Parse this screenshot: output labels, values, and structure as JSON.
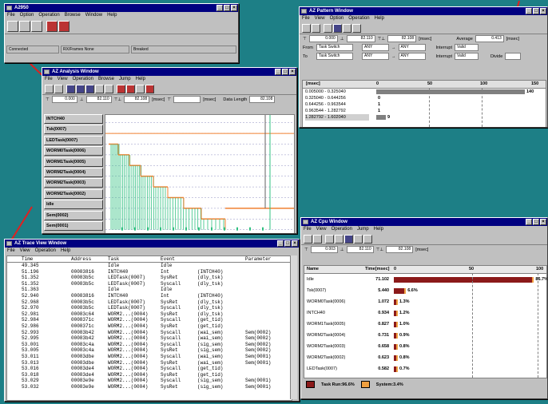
{
  "a2950": {
    "title": "A2950",
    "menu": [
      "File",
      "Option",
      "Operation",
      "Browse",
      "Window",
      "Help"
    ],
    "status": [
      "Connected",
      "RX/Frames None",
      "Breaked"
    ]
  },
  "analysis": {
    "title": "AZ Analysis Window",
    "menu": [
      "File",
      "View",
      "Operation",
      "Browse",
      "Jump",
      "Help"
    ],
    "t_start": "0.000",
    "t_end": "82.110",
    "t_range": "82.108",
    "unit": "[msec]",
    "data_length_label": "Data Length",
    "data_length": "82.108",
    "tasks": [
      "INTCH40",
      "Tsk(0007)",
      "LEDTask(0007)",
      "WORM0Task(0006)",
      "WORM1Task(0005)",
      "WORM2Task(0004)",
      "WORM2Task(0003)",
      "WORM2Task(0002)",
      "Idle",
      "Sem(0002)",
      "Sem(0001)"
    ]
  },
  "pattern": {
    "title": "AZ Pattern Window",
    "menu": [
      "File",
      "View",
      "Option",
      "Operation",
      "Help"
    ],
    "t_start": "0.000",
    "t_end": "82.110",
    "t_range": "82.108",
    "unit": "[msec]",
    "from_label": "From",
    "from_value": "Task Switch",
    "from_any1": "ANY",
    "from_any2": "ANY",
    "to_label": "To",
    "to_value": "Task Switch",
    "to_any1": "ANY",
    "to_any2": "ANY",
    "average_label": "Average",
    "average": "0.413",
    "unit2": "[msec]",
    "interrupt_label": "Interrupt",
    "interrupt_value": "Valid",
    "divide_label": "Divide",
    "col_range": "[msec]",
    "scale": [
      "0",
      "50",
      "100",
      "150"
    ],
    "rows": [
      {
        "range": "0.005000 - 0.325040",
        "count": "140",
        "frac": 0.93
      },
      {
        "range": "0.325040 - 0.644256",
        "count": "0",
        "frac": 0
      },
      {
        "range": "0.644256 - 0.963544",
        "count": "1",
        "frac": 0
      },
      {
        "range": "0.963544 - 1.282792",
        "count": "1",
        "frac": 0
      },
      {
        "range": "1.282792 - 1.602040",
        "count": "9",
        "frac": 0.06
      }
    ]
  },
  "cpu": {
    "title": "AZ Cpu Window",
    "menu": [
      "File",
      "View",
      "Operation",
      "Jump",
      "Help"
    ],
    "t_start": "0.003",
    "t_end": "82.110",
    "t_range": "82.108",
    "unit": "[msec]",
    "col_name": "Name",
    "col_time": "Time[msec]",
    "scale": [
      "0",
      "50",
      "100"
    ],
    "rows": [
      {
        "name": "Idle",
        "time": "71.102",
        "pct": "86.7%",
        "frac": 0.867
      },
      {
        "name": "Tsk(0007)",
        "time": "5.440",
        "pct": "6.6%",
        "frac": 0.066
      },
      {
        "name": "WORM0Task(0006)",
        "time": "1.072",
        "pct": "1.3%",
        "frac": 0.013
      },
      {
        "name": "INTCH40",
        "time": "0.934",
        "pct": "1.2%",
        "frac": 0.012
      },
      {
        "name": "WORM1Task(0005)",
        "time": "0.827",
        "pct": "1.0%",
        "frac": 0.01
      },
      {
        "name": "WORM2Task(0004)",
        "time": "0.731",
        "pct": "0.9%",
        "frac": 0.009
      },
      {
        "name": "WORM2Task(0003)",
        "time": "0.658",
        "pct": "0.8%",
        "frac": 0.008
      },
      {
        "name": "WORM2Task(0002)",
        "time": "0.623",
        "pct": "0.8%",
        "frac": 0.008
      },
      {
        "name": "LEDTask(0007)",
        "time": "0.582",
        "pct": "0.7%",
        "frac": 0.007
      }
    ],
    "legend_task": "Task Run:96.6%",
    "legend_system": "System:3.4%"
  },
  "trace": {
    "title": "AZ Trace View Window",
    "menu": [
      "File",
      "View",
      "Operation",
      "Help"
    ],
    "headers": [
      "Time",
      "Address",
      "Task",
      "Event",
      "",
      "Parameter"
    ],
    "rows": [
      [
        "49.345",
        "",
        "Idle",
        "Idle",
        "",
        ""
      ],
      [
        "51.196",
        "00083816",
        "INTCH40",
        "Int",
        "(INTCH40)",
        ""
      ],
      [
        "51.352",
        "00083b5c",
        "LEDTask(0007)",
        "SysRet",
        "(dly_tsk)",
        ""
      ],
      [
        "51.352",
        "00083b5c",
        "LEDTask(0007)",
        "Syscall",
        "(dly_tsk)",
        ""
      ],
      [
        "51.363",
        "",
        "Idle",
        "Idle",
        "",
        ""
      ],
      [
        "52.940",
        "00083816",
        "INTCH40",
        "Int",
        "(INTCH40)",
        ""
      ],
      [
        "52.968",
        "00083b5c",
        "LEDTask(0007)",
        "SysRet",
        "(dly_tsk)",
        ""
      ],
      [
        "52.970",
        "00083b5c",
        "LEDTask(0007)",
        "Syscall",
        "(dly_tsk)",
        ""
      ],
      [
        "52.981",
        "00083c64",
        "WORM2...(0004)",
        "SysRet",
        "(dly_tsk)",
        ""
      ],
      [
        "52.984",
        "0008371c",
        "WORM2...(0004)",
        "Syscall",
        "(get_tid)",
        ""
      ],
      [
        "52.986",
        "0008371c",
        "WORM2...(0004)",
        "SysRet",
        "(get_tid)",
        ""
      ],
      [
        "52.993",
        "00083b42",
        "WORM2...(0004)",
        "Syscall",
        "(wai_sem)",
        "Sem(0002)"
      ],
      [
        "52.995",
        "00083b42",
        "WORM2...(0004)",
        "Syscall",
        "(wai_sem)",
        "Sem(0002)"
      ],
      [
        "53.001",
        "00083c4a",
        "WORM2...(0004)",
        "Syscall",
        "(sig_sem)",
        "Sem(0002)"
      ],
      [
        "53.005",
        "00083c4a",
        "WORM2...(0004)",
        "SysRet",
        "(sig_sem)",
        "Sem(0002)"
      ],
      [
        "53.011",
        "00083dbe",
        "WORM2...(0004)",
        "Syscall",
        "(wai_sem)",
        "Sem(0001)"
      ],
      [
        "53.013",
        "00083dbe",
        "WORM2...(0004)",
        "SysRet",
        "(wai_sem)",
        "Sem(0001)"
      ],
      [
        "53.016",
        "00083de4",
        "WORM2...(0004)",
        "Syscall",
        "(get_tid)",
        ""
      ],
      [
        "53.018",
        "00083de4",
        "WORM2...(0004)",
        "SysRet",
        "(get_tid)",
        ""
      ],
      [
        "53.029",
        "00083e9e",
        "WORM2...(0004)",
        "Syscall",
        "(sig_sem)",
        "Sem(0001)"
      ],
      [
        "53.032",
        "00083e9e",
        "WORM2...(0004)",
        "SysRet",
        "(sig_sem)",
        "Sem(0001)"
      ]
    ]
  },
  "colors": {
    "desktop": "#1d7f86",
    "title_bar": "#000080",
    "cpu_bar": "#8b1a1a",
    "legend_system": "#f0a040",
    "timeline_green": "#30c080",
    "timeline_orange": "#f08030",
    "callout": "#e02020"
  }
}
